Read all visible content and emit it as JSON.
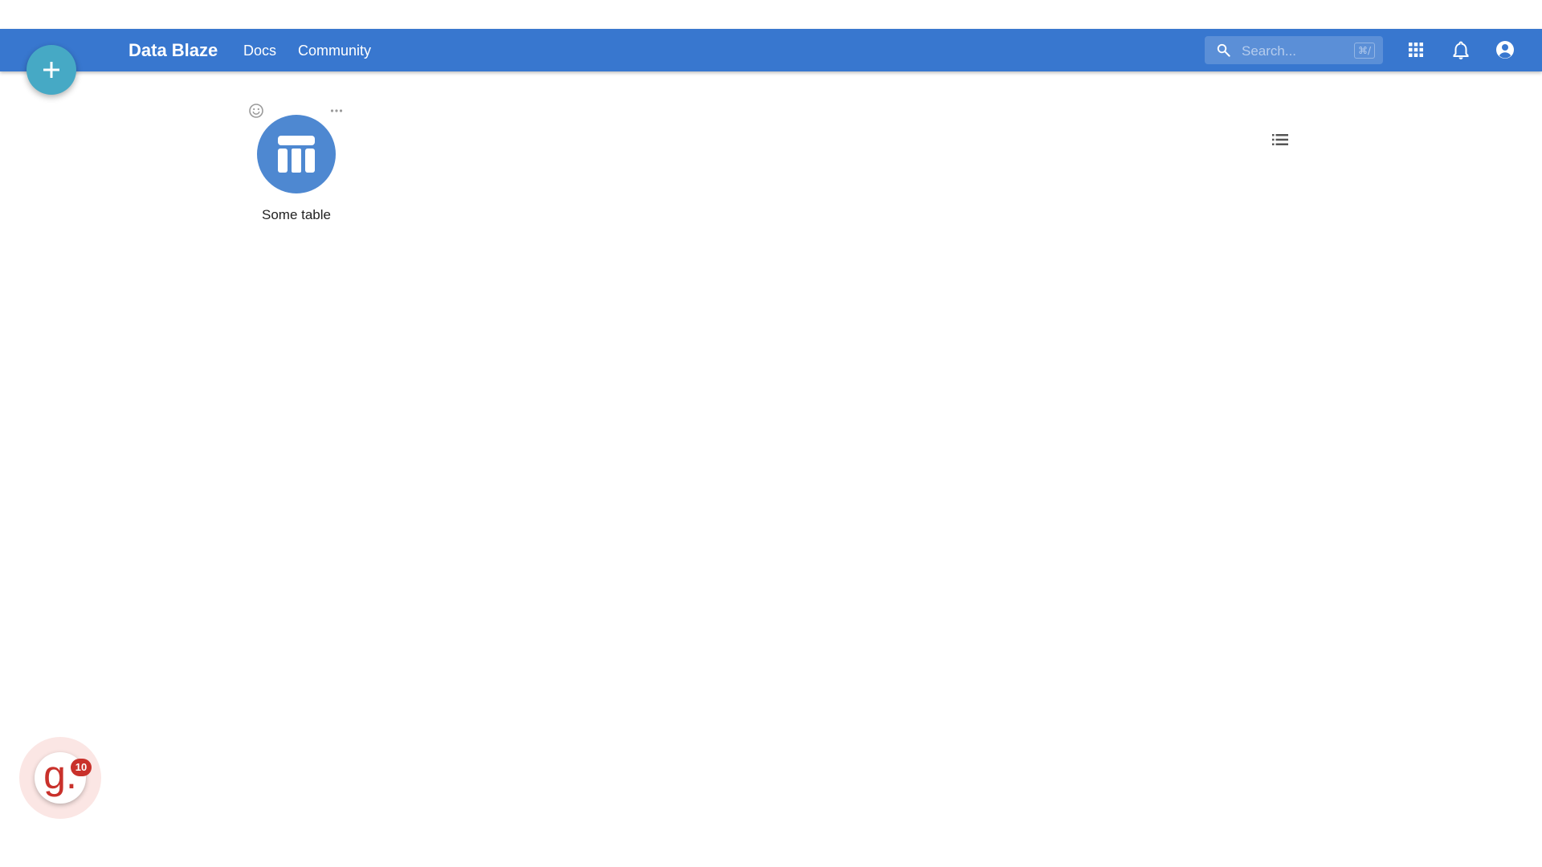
{
  "colors": {
    "header_bg": "#3877cf",
    "fab_bg": "#46a9c5",
    "table_tile_bg": "#4e88d1",
    "widget_accent": "#c9312b"
  },
  "header": {
    "brand": "Data Blaze",
    "nav": [
      {
        "label": "Docs"
      },
      {
        "label": "Community"
      }
    ],
    "search": {
      "placeholder": "Search...",
      "shortcut": "⌘/"
    },
    "icons": [
      "search-icon",
      "apps-grid-icon",
      "bell-icon",
      "account-circle-icon"
    ]
  },
  "fab": {
    "icon": "plus-icon"
  },
  "tables": [
    {
      "name": "Some table",
      "icon": "table-icon"
    }
  ],
  "card_actions": [
    "emoji-icon",
    "more-horizontal-icon"
  ],
  "view_toggle": {
    "icon": "list-view-icon"
  },
  "widget": {
    "letter": "g.",
    "badge": "10"
  }
}
